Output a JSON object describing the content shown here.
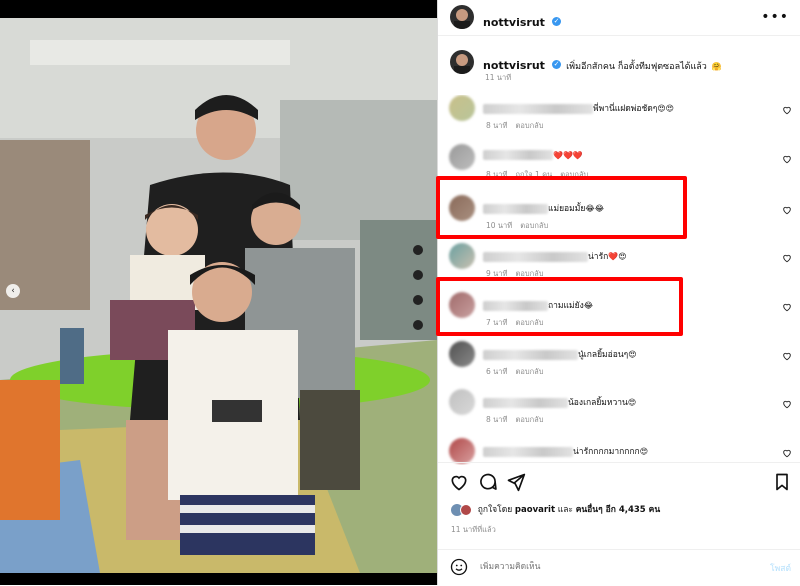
{
  "post": {
    "username": "nottvisrut",
    "caption": "เพิ่มอีกสักคน ก็อตั้งทีมฟุตซอลได้แล้ว",
    "caption_emoji": "🤗",
    "caption_time": "11 นาที"
  },
  "comments": [
    {
      "text": "พี่พานี่แฝดพ่อชัดๆ",
      "emoji": "😍😍",
      "meta": [
        "8 นาที",
        "ตอบกลับ"
      ],
      "name_w": 110
    },
    {
      "text": "",
      "emoji": "❤️❤️❤️",
      "meta": [
        "8 นาที",
        "ถูกใจ 1 คน",
        "ตอบกลับ"
      ],
      "name_w": 70
    },
    {
      "text": "แม่ยอมมั้ย",
      "emoji": "😂😂",
      "meta": [
        "10 นาที",
        "ตอบกลับ"
      ],
      "name_w": 65
    },
    {
      "text": "น่ารัก",
      "emoji": "❤️😍",
      "meta": [
        "9 นาที",
        "ตอบกลับ"
      ],
      "name_w": 105
    },
    {
      "text": "ถามแม่ยัง",
      "emoji": "😂",
      "meta": [
        "7 นาที",
        "ตอบกลับ"
      ],
      "name_w": 65
    },
    {
      "text": "นู๋เกลยิ้มอ่อนๆ",
      "emoji": "😍",
      "meta": [
        "6 นาที",
        "ตอบกลับ"
      ],
      "name_w": 95
    },
    {
      "text": "น้องเกลยิ้มหวาน",
      "emoji": "😍",
      "meta": [
        "8 นาที",
        "ตอบกลับ"
      ],
      "name_w": 85
    },
    {
      "text": "น่ารักกกกมากกกก",
      "emoji": "😍",
      "meta": [
        "",
        ""
      ],
      "name_w": 90
    }
  ],
  "likes": {
    "prefix": "ถูกใจโดย",
    "user": "paovarit",
    "suffix": "และ",
    "others": "คนอื่นๆ อีก 4,435 คน"
  },
  "post_time": "11 นาทีที่แล้ว",
  "add_comment": {
    "placeholder": "เพิ่มความคิดเห็น",
    "post_label": "โพสต์"
  },
  "icons": [
    "more-icon",
    "verified-icon",
    "heart-icon",
    "comment-icon",
    "share-icon",
    "bookmark-icon",
    "emoji-icon",
    "carousel-prev-icon"
  ],
  "colors": {
    "highlight": "#ff0000",
    "verified": "#3897f0",
    "meta": "#8e8e8e"
  }
}
